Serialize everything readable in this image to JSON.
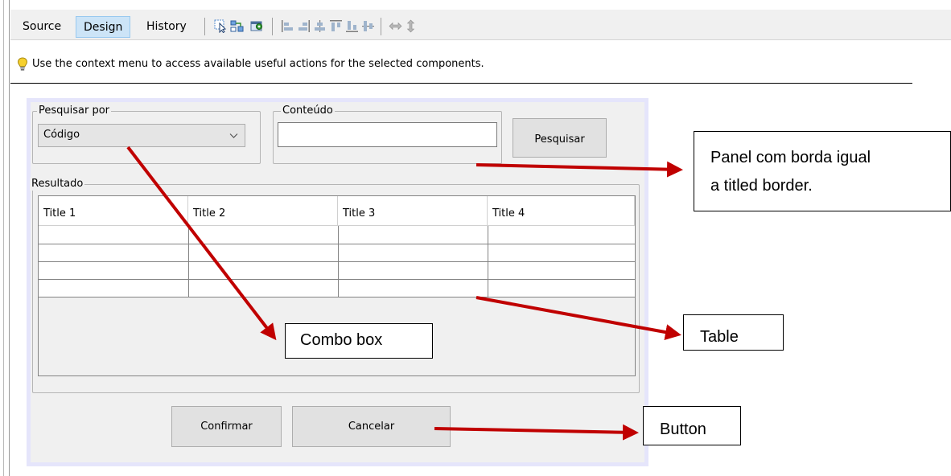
{
  "toolbar": {
    "tabs": [
      {
        "label": "Source",
        "active": false
      },
      {
        "label": "Design",
        "active": true
      },
      {
        "label": "History",
        "active": false
      }
    ],
    "icons": [
      "selection-mode-icon",
      "connection-mode-icon",
      "preview-design-icon",
      "align-left-icon",
      "align-right-icon",
      "center-horizontally-icon",
      "align-top-icon",
      "align-bottom-icon",
      "center-vertically-icon",
      "change-horizontal-resizability-icon",
      "change-vertical-resizability-icon"
    ]
  },
  "hint": {
    "icon": "lightbulb-icon",
    "text": "Use the context menu to access available useful actions for the selected components."
  },
  "form": {
    "search_by": {
      "title": "Pesquisar por",
      "selected": "Código"
    },
    "content": {
      "title": "Conteúdo",
      "value": ""
    },
    "search_button": "Pesquisar",
    "results": {
      "title": "Resultado",
      "columns": [
        "Title 1",
        "Title 2",
        "Title 3",
        "Title 4"
      ],
      "row_count": 4
    },
    "confirm_button": "Confirmar",
    "cancel_button": "Cancelar"
  },
  "annotations": {
    "panel_note": "Panel com borda igual a titled border.",
    "panel_note_line1": "Panel com borda igual",
    "panel_note_line2": "a titled border.",
    "combo_note": "Combo box",
    "table_note": "Table",
    "button_note": "Button",
    "arrow_color": "#c00000"
  },
  "colors": {
    "active_tab": "#cce4f7",
    "panel_highlight": "#e5e5fb",
    "form_background": "#f0f0f0"
  }
}
